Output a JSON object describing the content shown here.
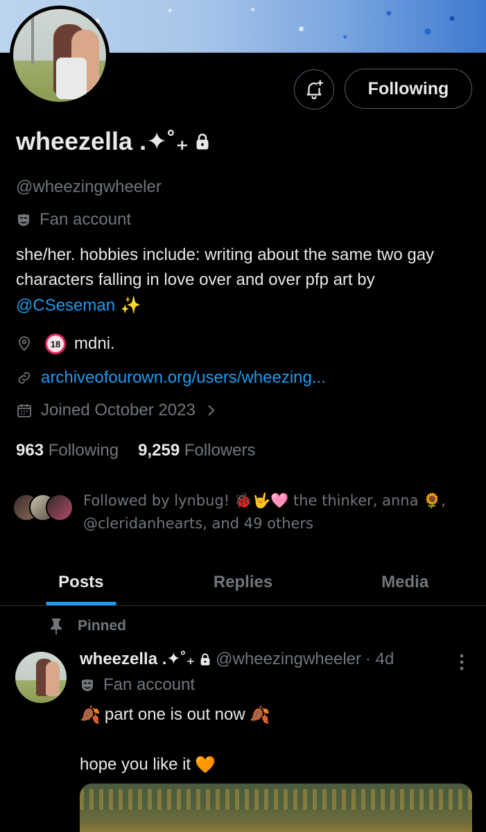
{
  "header": {
    "follow_button_label": "Following"
  },
  "profile": {
    "display_name": "wheezella .✦˚₊",
    "handle": "@wheezingwheeler",
    "category": "Fan account",
    "bio_prefix": "she/her.  hobbies include: writing about the same two gay characters falling in love over and over  pfp art by ",
    "bio_mention": "@CSeseman",
    "bio_suffix": " ✨",
    "location": "mdni.",
    "location_badge": "🔞",
    "url": "archiveofourown.org/users/wheezing...",
    "joined": "Joined October 2023",
    "following_count": "963",
    "following_label": "Following",
    "followers_count": "9,259",
    "followers_label": "Followers",
    "followed_by_text": "Followed by lynbug! 🐞🤟🩷 the thinker, anna 🌻, @cleridanhearts, and 49 others"
  },
  "tabs": [
    {
      "label": "Posts",
      "active": true
    },
    {
      "label": "Replies",
      "active": false
    },
    {
      "label": "Media",
      "active": false
    }
  ],
  "post": {
    "pinned_label": "Pinned",
    "author_name": "wheezella .✦˚₊",
    "author_handle": "@wheezingwheeler",
    "time": "· 4d",
    "author_category": "Fan account",
    "line1_text": "part one is out now",
    "line1_emoji": "🍂",
    "line2_text": "hope you like it",
    "line2_emoji": "🧡"
  },
  "colors": {
    "background": "#000000",
    "text_primary": "#e7e9ea",
    "text_secondary": "#71767b",
    "accent": "#1d9bf0",
    "border": "#536471"
  },
  "icons": {
    "lock": "lock-icon",
    "bell": "bell-plus-icon",
    "mask": "mask-icon",
    "location": "location-pin-icon",
    "link": "link-icon",
    "calendar": "calendar-icon",
    "chevron": "chevron-right-icon",
    "pin": "pin-icon",
    "more": "more-vertical-icon"
  }
}
